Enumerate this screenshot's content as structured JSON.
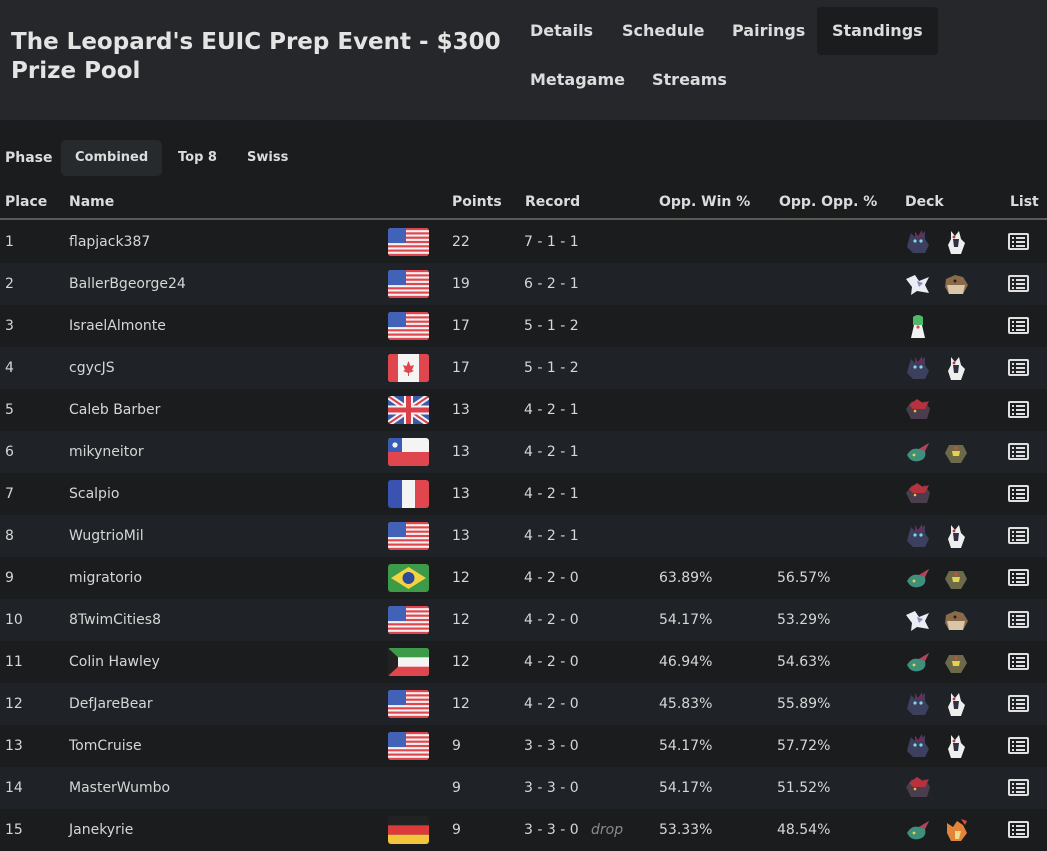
{
  "event": {
    "title": "The Leopard's EUIC Prep Event - $300 Prize Pool"
  },
  "nav": {
    "tabs": [
      {
        "label": "Details"
      },
      {
        "label": "Schedule"
      },
      {
        "label": "Pairings"
      },
      {
        "label": "Standings",
        "active": true
      },
      {
        "label": "Metagame"
      },
      {
        "label": "Streams"
      }
    ]
  },
  "phase": {
    "label": "Phase",
    "options": [
      {
        "label": "Combined",
        "active": true
      },
      {
        "label": "Top 8"
      },
      {
        "label": "Swiss"
      }
    ]
  },
  "table": {
    "headers": {
      "place": "Place",
      "name": "Name",
      "points": "Points",
      "record": "Record",
      "opp_win": "Opp. Win %",
      "opp_opp": "Opp. Opp. %",
      "deck": "Deck",
      "list": "List"
    },
    "rows": [
      {
        "place": "1",
        "name": "flapjack387",
        "country": "US",
        "points": "22",
        "record": "7 - 1 - 1",
        "drop": "",
        "opp_win": "",
        "opp_opp": "",
        "deck": [
          "zoroark",
          "lycanroc"
        ]
      },
      {
        "place": "2",
        "name": "BallerBgeorge24",
        "country": "US",
        "points": "19",
        "record": "6 - 2 - 1",
        "drop": "",
        "opp_win": "",
        "opp_opp": "",
        "deck": [
          "pegasus",
          "stoutland"
        ]
      },
      {
        "place": "3",
        "name": "IsraelAlmonte",
        "country": "US",
        "points": "17",
        "record": "5 - 1 - 2",
        "drop": "",
        "opp_win": "",
        "opp_opp": "",
        "deck": [
          "gardevoir"
        ]
      },
      {
        "place": "4",
        "name": "cgycJS",
        "country": "CA",
        "points": "17",
        "record": "5 - 1 - 2",
        "drop": "",
        "opp_win": "",
        "opp_opp": "",
        "deck": [
          "zoroark",
          "lycanroc"
        ]
      },
      {
        "place": "5",
        "name": "Caleb Barber",
        "country": "GB",
        "points": "13",
        "record": "4 - 2 - 1",
        "drop": "",
        "opp_win": "",
        "opp_opp": "",
        "deck": [
          "hisuian-zoroark"
        ]
      },
      {
        "place": "6",
        "name": "mikyneitor",
        "country": "CL",
        "points": "13",
        "record": "4 - 2 - 1",
        "drop": "",
        "opp_win": "",
        "opp_opp": "",
        "deck": [
          "dragapult",
          "dusknoir"
        ]
      },
      {
        "place": "7",
        "name": "Scalpio",
        "country": "FR",
        "points": "13",
        "record": "4 - 2 - 1",
        "drop": "",
        "opp_win": "",
        "opp_opp": "",
        "deck": [
          "hisuian-zoroark"
        ]
      },
      {
        "place": "8",
        "name": "WugtrioMil",
        "country": "US",
        "points": "13",
        "record": "4 - 2 - 1",
        "drop": "",
        "opp_win": "",
        "opp_opp": "",
        "deck": [
          "zoroark",
          "lycanroc"
        ]
      },
      {
        "place": "9",
        "name": "migratorio",
        "country": "BR",
        "points": "12",
        "record": "4 - 2 - 0",
        "drop": "",
        "opp_win": "63.89%",
        "opp_opp": "56.57%",
        "deck": [
          "dragapult",
          "dusknoir"
        ]
      },
      {
        "place": "10",
        "name": "8TwimCities8",
        "country": "US",
        "points": "12",
        "record": "4 - 2 - 0",
        "drop": "",
        "opp_win": "54.17%",
        "opp_opp": "53.29%",
        "deck": [
          "pegasus",
          "stoutland"
        ]
      },
      {
        "place": "11",
        "name": "Colin Hawley",
        "country": "KW",
        "points": "12",
        "record": "4 - 2 - 0",
        "drop": "",
        "opp_win": "46.94%",
        "opp_opp": "54.63%",
        "deck": [
          "dragapult",
          "dusknoir"
        ]
      },
      {
        "place": "12",
        "name": "DefJareBear",
        "country": "US",
        "points": "12",
        "record": "4 - 2 - 0",
        "drop": "",
        "opp_win": "45.83%",
        "opp_opp": "55.89%",
        "deck": [
          "zoroark",
          "lycanroc"
        ]
      },
      {
        "place": "13",
        "name": "TomCruise",
        "country": "US",
        "points": "9",
        "record": "3 - 3 - 0",
        "drop": "",
        "opp_win": "54.17%",
        "opp_opp": "57.72%",
        "deck": [
          "zoroark",
          "lycanroc"
        ]
      },
      {
        "place": "14",
        "name": "MasterWumbo",
        "country": "",
        "points": "9",
        "record": "3 - 3 - 0",
        "drop": "",
        "opp_win": "54.17%",
        "opp_opp": "51.52%",
        "deck": [
          "hisuian-zoroark"
        ]
      },
      {
        "place": "15",
        "name": "Janekyrie",
        "country": "DE",
        "points": "9",
        "record": "3 - 3 - 0",
        "drop": "drop",
        "opp_win": "53.33%",
        "opp_opp": "48.54%",
        "deck": [
          "dragapult",
          "charizard"
        ]
      }
    ]
  }
}
